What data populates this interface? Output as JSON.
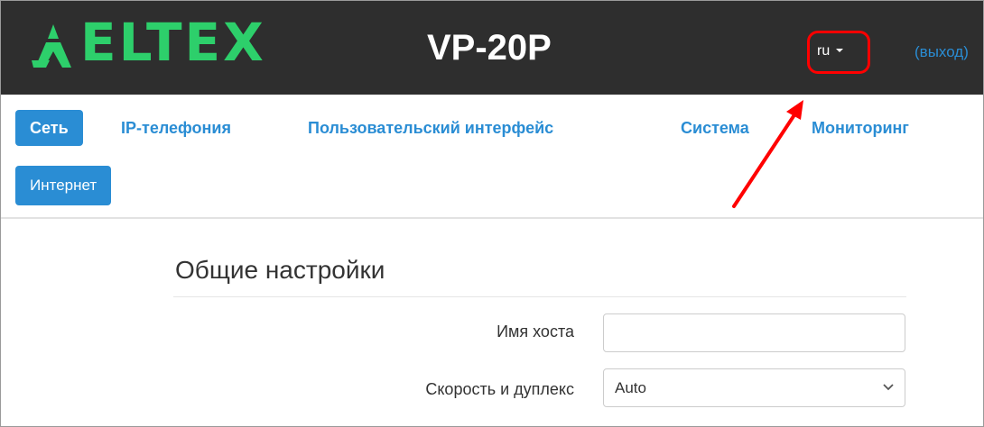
{
  "header": {
    "logo_text": "ELTEX",
    "model": "VP-20P",
    "language": "ru",
    "logout": "(выход)"
  },
  "nav": {
    "tabs": [
      {
        "label": "Сеть",
        "active": true
      },
      {
        "label": "IP-телефония",
        "active": false
      },
      {
        "label": "Пользовательский интерфейс",
        "active": false
      },
      {
        "label": "Система",
        "active": false
      },
      {
        "label": "Мониторинг",
        "active": false
      }
    ],
    "subtabs": [
      {
        "label": "Интернет",
        "active": true
      }
    ]
  },
  "form": {
    "section_title": "Общие настройки",
    "hostname": {
      "label": "Имя хоста",
      "value": "",
      "placeholder": ""
    },
    "speed_duplex": {
      "label": "Скорость и дуплекс",
      "value": "Auto"
    }
  },
  "annotation": {
    "color": "#ff0000",
    "target": "language-selector"
  },
  "colors": {
    "accent": "#2a8dd4",
    "header_bg": "#2e2e2e",
    "logo": "#2dcf6b"
  }
}
